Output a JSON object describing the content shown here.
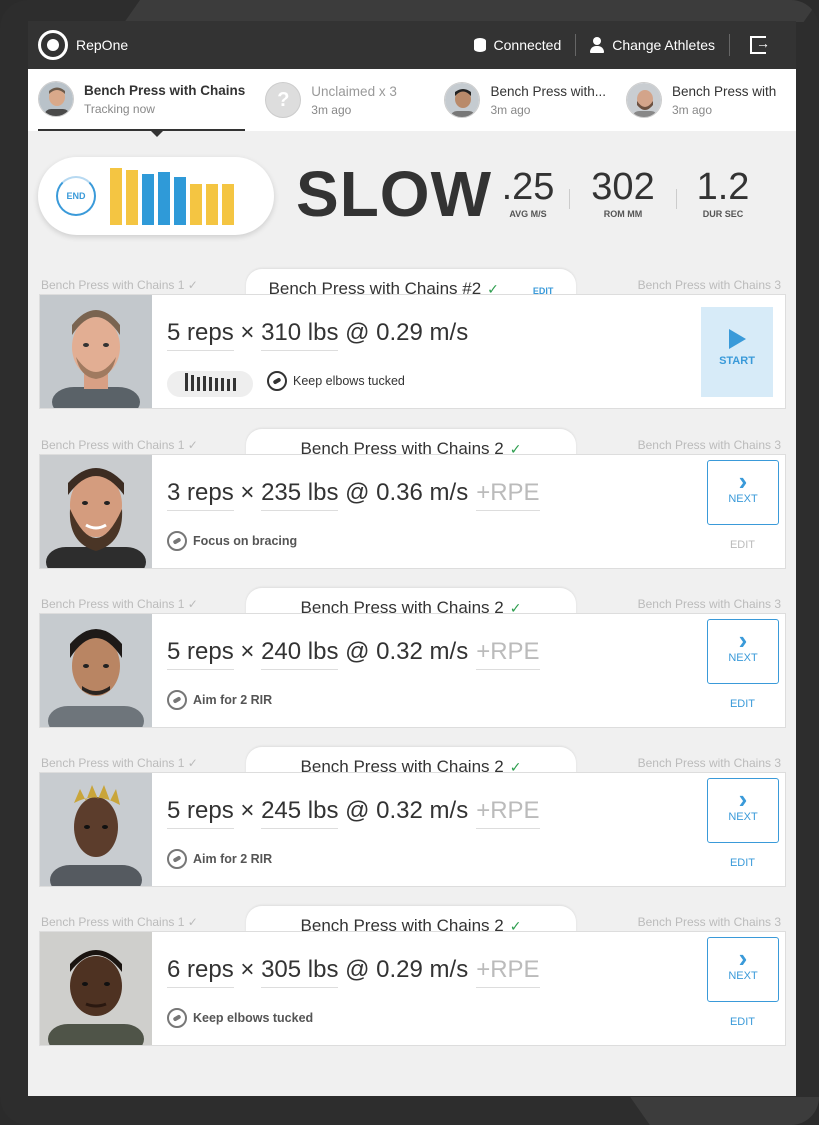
{
  "app": {
    "name": "RepOne"
  },
  "topbar": {
    "connected_label": "Connected",
    "change_athletes_label": "Change Athletes"
  },
  "athlete_tabs": [
    {
      "name": "Bench Press with Chains",
      "sub": "Tracking now",
      "active": true
    },
    {
      "name": "Unclaimed x 3",
      "sub": "3m ago",
      "active": false,
      "avatar": "?"
    },
    {
      "name": "Bench Press with...",
      "sub": "3m ago",
      "active": false
    },
    {
      "name": "Bench Press with",
      "sub": "3m ago",
      "active": false
    }
  ],
  "status": {
    "end_label": "END",
    "speed_label": "SLOW",
    "metrics": [
      {
        "value": ".25",
        "label": "AVG M/S"
      },
      {
        "value": "302",
        "label": "ROM MM"
      },
      {
        "value": "1.2",
        "label": "DUR SEC"
      }
    ],
    "bar_colors": {
      "yellow": "#f4c542",
      "blue": "#2f9ad8"
    },
    "mini_bars": [
      {
        "value": 0.95,
        "color": "yellow"
      },
      {
        "value": 0.92,
        "color": "yellow"
      },
      {
        "value": 0.85,
        "color": "blue"
      },
      {
        "value": 0.88,
        "color": "blue"
      },
      {
        "value": 0.8,
        "color": "blue"
      },
      {
        "value": 0.68,
        "color": "yellow"
      },
      {
        "value": 0.68,
        "color": "yellow"
      },
      {
        "value": 0.68,
        "color": "yellow"
      }
    ]
  },
  "sets": [
    {
      "left_label": "Bench Press with Chains 1 ✓",
      "title": "Bench Press with Chains #2",
      "right_label": "Bench Press with Chains 3",
      "edit_label": "EDIT",
      "reps": "5 reps",
      "weight": "310 lbs",
      "velocity": "@ 0.29 m/s",
      "rpe": "",
      "cue": "Keep elbows tucked",
      "button": "START",
      "under_edit": "",
      "active": true,
      "rep_ticks": [
        1,
        0.9,
        0.8,
        0.85,
        0.75,
        0.7,
        0.7,
        0.65,
        0.7
      ]
    },
    {
      "left_label": "Bench Press with Chains 1 ✓",
      "title": "Bench Press with Chains 2",
      "right_label": "Bench Press with Chains 3",
      "reps": "3 reps",
      "weight": "235 lbs",
      "velocity": "@ 0.36 m/s",
      "rpe": "+RPE",
      "cue": "Focus on bracing",
      "button": "NEXT",
      "under_edit": "EDIT",
      "active": false
    },
    {
      "left_label": "Bench Press with Chains 1 ✓",
      "title": "Bench Press with Chains 2",
      "right_label": "Bench Press with Chains 3",
      "reps": "5 reps",
      "weight": "240 lbs",
      "velocity": "@ 0.32 m/s",
      "rpe": "+RPE",
      "cue": "Aim for 2 RIR",
      "button": "NEXT",
      "under_edit": "EDIT",
      "active": false
    },
    {
      "left_label": "Bench Press with Chains 1 ✓",
      "title": "Bench Press with Chains 2",
      "right_label": "Bench Press with Chains 3",
      "reps": "5 reps",
      "weight": "245 lbs",
      "velocity": "@ 0.32 m/s",
      "rpe": "+RPE",
      "cue": "Aim for 2 RIR",
      "button": "NEXT",
      "under_edit": "EDIT",
      "active": false
    },
    {
      "left_label": "Bench Press with Chains 1 ✓",
      "title": "Bench Press with Chains 2",
      "right_label": "Bench Press with Chains 3",
      "reps": "6 reps",
      "weight": "305 lbs",
      "velocity": "@ 0.29 m/s",
      "rpe": "+RPE",
      "cue": "Keep elbows tucked",
      "button": "NEXT",
      "under_edit": "EDIT",
      "active": false
    }
  ]
}
